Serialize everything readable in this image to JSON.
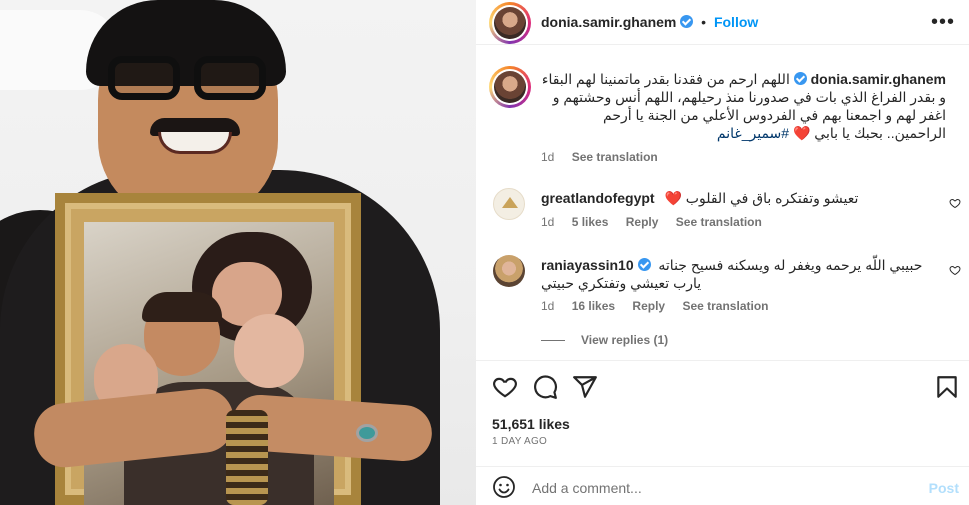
{
  "post_header": {
    "username": "donia.samir.ghanem",
    "separator": "•",
    "follow_label": "Follow",
    "more_icon": "more-options-icon",
    "more_glyph": "•••"
  },
  "caption": {
    "username": "donia.samir.ghanem",
    "text": "اللهم ارحم من فقدنا بقدر ماتمنينا لهم البقاء و بقدر الفراغ الذي بات في صدورنا منذ رحيلهم، اللهم أنس وحشتهم و اغفر لهم و اجمعنا بهم في الفردوس الأعلي من الجنة يا أرحم الراحمين.. بحبك يا بابي ",
    "hashtag": "#سمير_غانم",
    "heart_emoji": "❤️",
    "time": "1d",
    "see_translation": "See translation"
  },
  "comments": [
    {
      "username": "greatlandofegypt",
      "text": "تعيشو وتفتكره باق في القلوب",
      "emoji": "❤️",
      "time": "1d",
      "likes": "5 likes",
      "reply": "Reply",
      "see_translation": "See translation",
      "verified": false
    },
    {
      "username": "raniayassin10",
      "text_line1": "حبيبي اللّه يرحمه ويغفر له ويسكنه فسيح جناته",
      "text_line2": "يارب تعيشي وتفتكري حبيتي",
      "time": "1d",
      "likes": "16 likes",
      "reply": "Reply",
      "see_translation": "See translation",
      "verified": true
    }
  ],
  "view_replies": "View replies (1)",
  "actions": {
    "like_icon": "heart-outline-icon",
    "comment_icon": "comment-icon",
    "share_icon": "share-icon",
    "save_icon": "bookmark-icon"
  },
  "likes_count": "51,651 likes",
  "post_date": "1 DAY AGO",
  "add_comment": {
    "placeholder": "Add a comment...",
    "post_label": "Post",
    "emoji_icon": "emoji-icon"
  },
  "colors": {
    "accent": "#0095f6",
    "verified": "#3897f0",
    "secondary_text": "#737373",
    "heart": "#ed4956",
    "post_disabled": "#b2dffc"
  }
}
